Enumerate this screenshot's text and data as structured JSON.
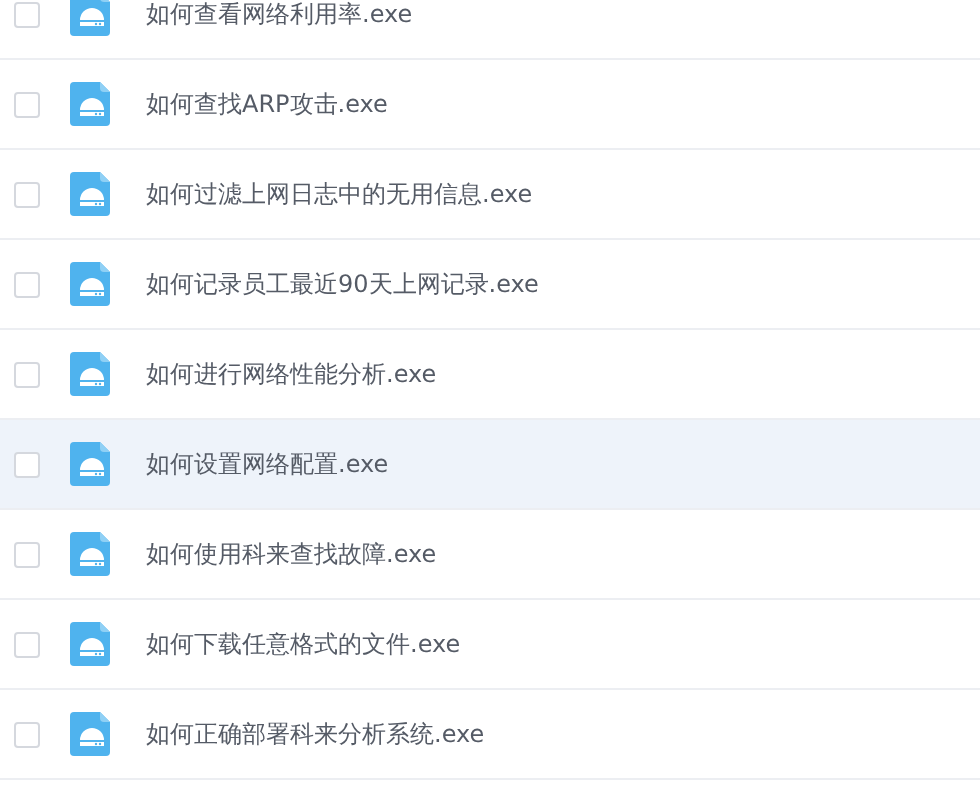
{
  "files": [
    {
      "name": "如何查看网络利用率.exe",
      "checked": false,
      "hovered": false
    },
    {
      "name": "如何查找ARP攻击.exe",
      "checked": false,
      "hovered": false
    },
    {
      "name": "如何过滤上网日志中的无用信息.exe",
      "checked": false,
      "hovered": false
    },
    {
      "name": "如何记录员工最近90天上网记录.exe",
      "checked": false,
      "hovered": false
    },
    {
      "name": "如何进行网络性能分析.exe",
      "checked": false,
      "hovered": false
    },
    {
      "name": "如何设置网络配置.exe",
      "checked": false,
      "hovered": true
    },
    {
      "name": "如何使用科来查找故障.exe",
      "checked": false,
      "hovered": false
    },
    {
      "name": "如何下载任意格式的文件.exe",
      "checked": false,
      "hovered": false
    },
    {
      "name": "如何正确部署科来分析系统.exe",
      "checked": false,
      "hovered": false
    }
  ]
}
